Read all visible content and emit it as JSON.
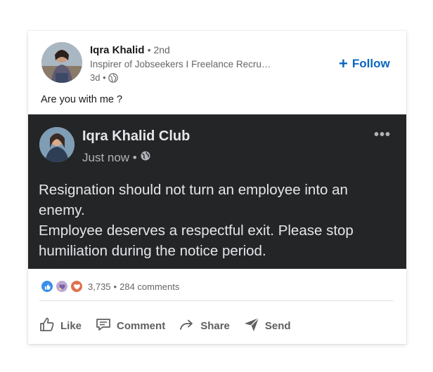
{
  "post": {
    "author_name": "Iqra Khalid",
    "degree": "• 2nd",
    "headline": "Inspirer of Jobseekers I Freelance Recruiter | Digi...",
    "time": "3d •",
    "follow_label": "Follow",
    "caption": "Are you with me ?"
  },
  "embed": {
    "name": "Iqra Khalid Club",
    "time": "Just now •",
    "more": "•••",
    "lines": [
      "Resignation should not turn an employee into an",
      "enemy.",
      "Employee deserves a respectful exit. Please stop",
      "humiliation during the notice period."
    ]
  },
  "social": {
    "reaction_count": "3,735",
    "separator": "•",
    "comments": "284 comments"
  },
  "actions": {
    "like": "Like",
    "comment": "Comment",
    "share": "Share",
    "send": "Send"
  },
  "colors": {
    "accent": "#0a66c2",
    "embed_bg": "#242526",
    "like_reaction": "#378fe9",
    "support_reaction": "#bba9d1",
    "love_reaction": "#df704d"
  },
  "icons": [
    "globe-icon",
    "plus-icon",
    "more-icon",
    "like-reaction-icon",
    "support-reaction-icon",
    "love-reaction-icon",
    "like-icon",
    "comment-icon",
    "share-icon",
    "send-icon"
  ]
}
